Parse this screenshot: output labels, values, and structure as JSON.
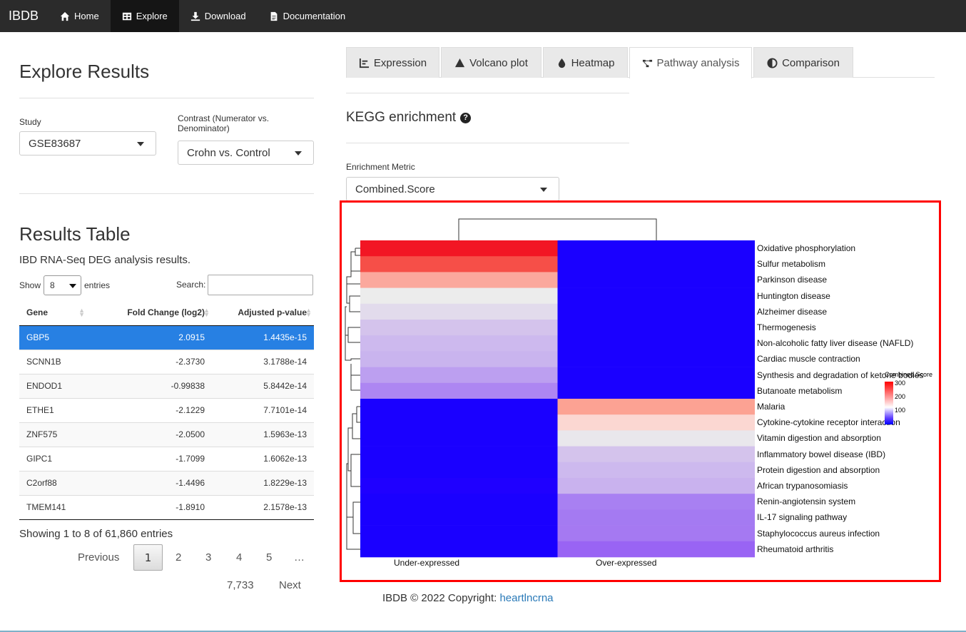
{
  "nav": {
    "brand": "IBDB",
    "items": [
      {
        "label": "Home",
        "icon": "home-icon"
      },
      {
        "label": "Explore",
        "icon": "table-icon"
      },
      {
        "label": "Download",
        "icon": "download-icon"
      },
      {
        "label": "Documentation",
        "icon": "document-icon"
      }
    ]
  },
  "sidebar": {
    "title": "Explore Results",
    "study_label": "Study",
    "study_value": "GSE83687",
    "contrast_label": "Contrast (Numerator vs. Denominator)",
    "contrast_value": "Crohn vs. Control",
    "results_title": "Results Table",
    "results_subtitle": "IBD RNA-Seq DEG analysis results.",
    "show_label": "Show",
    "show_value": "8",
    "entries_label": "entries",
    "search_label": "Search:",
    "columns": [
      "Gene",
      "Fold Change (log2)",
      "Adjusted p-value"
    ],
    "rows": [
      {
        "gene": "GBP5",
        "fc": "2.0915",
        "p": "1.4435e-15"
      },
      {
        "gene": "SCNN1B",
        "fc": "-2.3730",
        "p": "3.1788e-14"
      },
      {
        "gene": "ENDOD1",
        "fc": "-0.99838",
        "p": "5.8442e-14"
      },
      {
        "gene": "ETHE1",
        "fc": "-2.1229",
        "p": "7.7101e-14"
      },
      {
        "gene": "ZNF575",
        "fc": "-2.0500",
        "p": "1.5963e-13"
      },
      {
        "gene": "GIPC1",
        "fc": "-1.7099",
        "p": "1.6062e-13"
      },
      {
        "gene": "C2orf88",
        "fc": "-1.4496",
        "p": "1.8229e-13"
      },
      {
        "gene": "TMEM141",
        "fc": "-1.8910",
        "p": "2.1578e-13"
      }
    ],
    "info": "Showing 1 to 8 of 61,860 entries",
    "pagination": {
      "previous": "Previous",
      "pages": [
        "1",
        "2",
        "3",
        "4",
        "5",
        "…"
      ],
      "last": "7,733",
      "next": "Next"
    }
  },
  "tabs": [
    {
      "label": "Expression",
      "icon": "line-chart-icon"
    },
    {
      "label": "Volcano plot",
      "icon": "triangle-icon"
    },
    {
      "label": "Heatmap",
      "icon": "droplet-icon"
    },
    {
      "label": "Pathway analysis",
      "icon": "network-icon"
    },
    {
      "label": "Comparison",
      "icon": "half-circle-icon"
    }
  ],
  "pathway": {
    "title": "KEGG enrichment",
    "metric_label": "Enrichment Metric",
    "metric_value": "Combined.Score"
  },
  "chart_data": {
    "type": "heatmap",
    "columns": [
      "Under-expressed",
      "Over-expressed"
    ],
    "rows": [
      "Oxidative phosphorylation",
      "Sulfur metabolism",
      "Parkinson disease",
      "Huntington disease",
      "Alzheimer disease",
      "Thermogenesis",
      "Non-alcoholic fatty liver disease (NAFLD)",
      "Cardiac muscle contraction",
      "Synthesis and degradation of ketone bodies",
      "Butanoate metabolism",
      "Malaria",
      "Cytokine-cytokine receptor interaction",
      "Vitamin digestion and absorption",
      "Inflammatory bowel disease (IBD)",
      "Protein digestion and absorption",
      "African trypanosomiasis",
      "Renin-angiotensin system",
      "IL-17 signaling pathway",
      "Staphylococcus aureus infection",
      "Rheumatoid arthritis"
    ],
    "cell_colors": [
      [
        "#f21624",
        "#1a00ff"
      ],
      [
        "#f64f48",
        "#1a00ff"
      ],
      [
        "#fba89d",
        "#1a00ff"
      ],
      [
        "#ececec",
        "#1a00ff"
      ],
      [
        "#e2dbec",
        "#1a00ff"
      ],
      [
        "#d4c3ec",
        "#1a00ff"
      ],
      [
        "#cdb9ee",
        "#1a00ff"
      ],
      [
        "#c9b4ee",
        "#1a00ff"
      ],
      [
        "#bc9ff0",
        "#1a00ff"
      ],
      [
        "#ad86f2",
        "#1a00ff"
      ],
      [
        "#1a00ff",
        "#fca293"
      ],
      [
        "#1a00ff",
        "#fbd7d2"
      ],
      [
        "#1a00ff",
        "#e9e7ec"
      ],
      [
        "#1a00ff",
        "#d4c3ec"
      ],
      [
        "#1a00ff",
        "#cdb9ee"
      ],
      [
        "#1f00ff",
        "#c9b2ee"
      ],
      [
        "#1a00ff",
        "#a880f2"
      ],
      [
        "#1a00ff",
        "#a47af2"
      ],
      [
        "#1a00ff",
        "#a579f2"
      ],
      [
        "#1a00ff",
        "#9964f4"
      ]
    ],
    "legend": {
      "title": "Combined.Score",
      "ticks": [
        "300",
        "200",
        "100"
      ]
    }
  },
  "footer": {
    "text": "IBDB © 2022 Copyright: ",
    "link": "heartlncrna"
  }
}
